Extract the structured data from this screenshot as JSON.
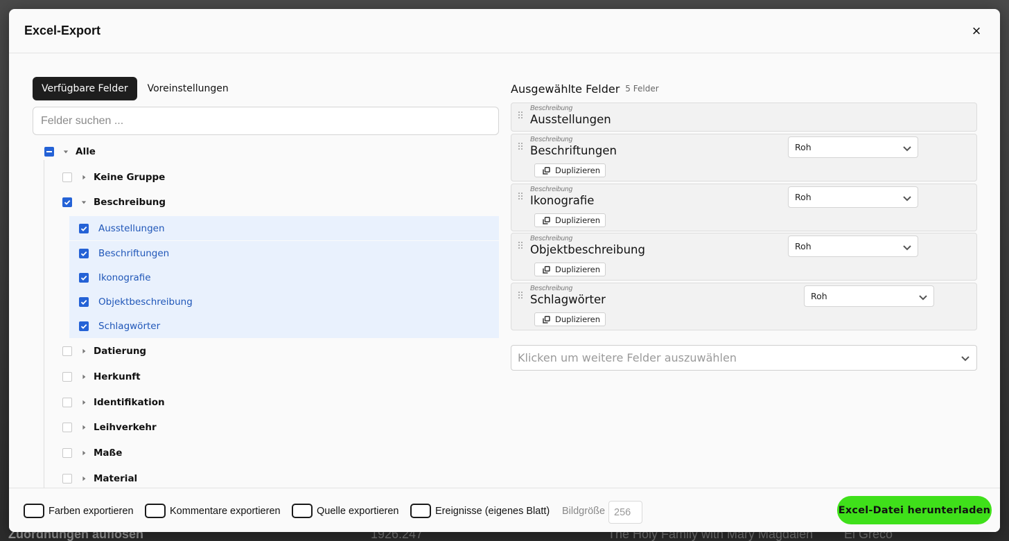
{
  "modal": {
    "title": "Excel-Export",
    "close_label": "×"
  },
  "tabs": [
    {
      "label": "Verfügbare Felder",
      "active": true
    },
    {
      "label": "Voreinstellungen",
      "active": false
    }
  ],
  "search": {
    "placeholder": "Felder suchen ...",
    "value": ""
  },
  "tree": {
    "root": {
      "label": "Alle",
      "state": "mixed",
      "expanded": true
    },
    "groups": [
      {
        "label": "Keine Gruppe",
        "checked": false,
        "expanded": false
      },
      {
        "label": "Beschreibung",
        "checked": true,
        "expanded": true,
        "children": [
          {
            "label": "Ausstellungen",
            "checked": true
          },
          {
            "label": "Beschriftungen",
            "checked": true
          },
          {
            "label": "Ikonografie",
            "checked": true
          },
          {
            "label": "Objektbeschreibung",
            "checked": true
          },
          {
            "label": "Schlagwörter",
            "checked": true
          }
        ]
      },
      {
        "label": "Datierung",
        "checked": false,
        "expanded": false
      },
      {
        "label": "Herkunft",
        "checked": false,
        "expanded": false
      },
      {
        "label": "Identifikation",
        "checked": false,
        "expanded": false
      },
      {
        "label": "Leihverkehr",
        "checked": false,
        "expanded": false
      },
      {
        "label": "Maße",
        "checked": false,
        "expanded": false
      },
      {
        "label": "Material",
        "checked": false,
        "expanded": false
      }
    ]
  },
  "selected": {
    "title": "Ausgewählte Felder",
    "count": "5 Felder",
    "fields": [
      {
        "group": "Beschreibung",
        "name": "Ausstellungen",
        "format": "",
        "duplicate": ""
      },
      {
        "group": "Beschreibung",
        "name": "Beschriftungen",
        "format": "Roh",
        "duplicate": "Duplizieren"
      },
      {
        "group": "Beschreibung",
        "name": "Ikonografie",
        "format": "Roh",
        "duplicate": "Duplizieren"
      },
      {
        "group": "Beschreibung",
        "name": "Objektbeschreibung",
        "format": "Roh",
        "duplicate": "Duplizieren"
      },
      {
        "group": "Beschreibung",
        "name": "Schlagwörter",
        "format": "Roh",
        "duplicate": "Duplizieren"
      }
    ],
    "add_placeholder": "Klicken um weitere Felder auszuwählen"
  },
  "footer": {
    "options": [
      {
        "label": "Farben exportieren",
        "checked": false
      },
      {
        "label": "Kommentare exportieren",
        "checked": false
      },
      {
        "label": "Quelle exportieren",
        "checked": false
      },
      {
        "label": "Ereignisse (eigenes Blatt)",
        "checked": false
      }
    ],
    "image_size_label": "Bildgröße",
    "image_size_value": "256",
    "download_label": "Excel-Datei herunterladen"
  },
  "background": {
    "left_text": "Zuordnungen auflösen",
    "number": "1926.247",
    "title": "The Holy Family with Mary Magdalen",
    "artist": "El Greco"
  },
  "colors": {
    "accent": "#2462d6",
    "download": "#3fe01a",
    "selected_row": "#e9f1fd"
  }
}
